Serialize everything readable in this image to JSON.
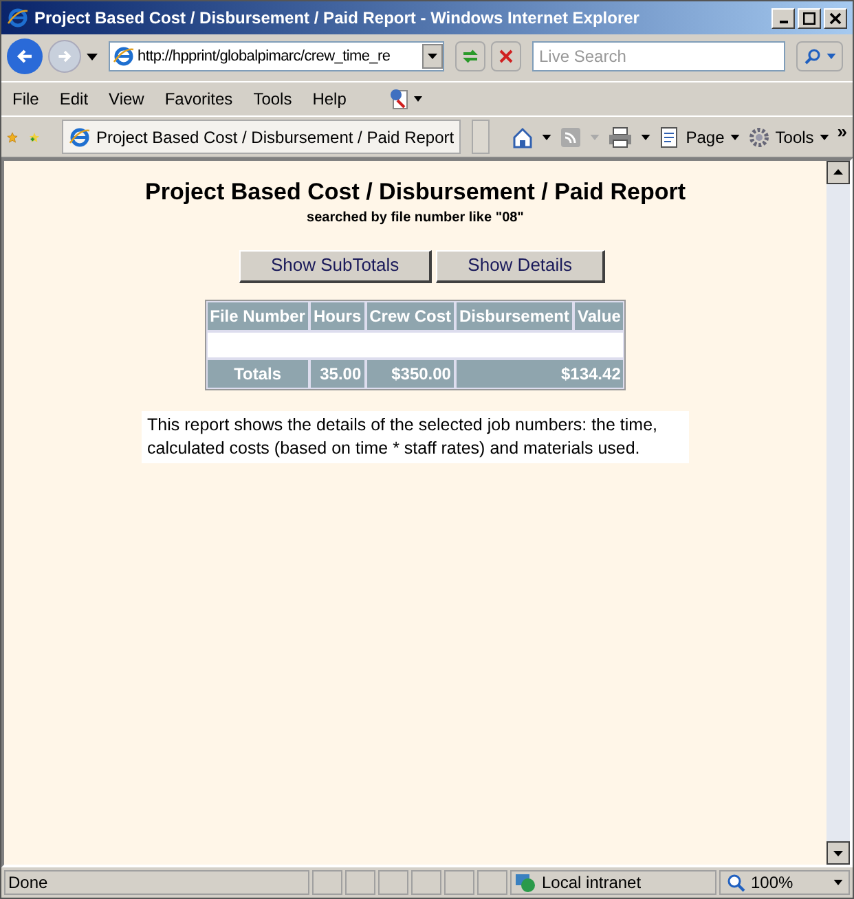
{
  "window": {
    "title": "Project Based Cost / Disbursement / Paid Report - Windows Internet Explorer"
  },
  "address_bar": {
    "value": "http://hpprint/globalpimarc/crew_time_re"
  },
  "search": {
    "placeholder": "Live Search"
  },
  "menu": [
    "File",
    "Edit",
    "View",
    "Favorites",
    "Tools",
    "Help"
  ],
  "tab": {
    "label": "Project Based Cost / Disbursement / Paid Report"
  },
  "command_bar": {
    "page": "Page",
    "tools": "Tools",
    "more": "»"
  },
  "report": {
    "title": "Project Based Cost / Disbursement / Paid Report",
    "subtitle": "searched by file number like \"08\"",
    "buttons": [
      "Show SubTotals",
      "Show Details"
    ],
    "table": {
      "columns": [
        "File Number",
        "Hours",
        "Crew Cost",
        "Disbursement",
        "Value"
      ],
      "totals": [
        "Totals",
        "35.00",
        "$350.00",
        "$134.42"
      ]
    },
    "note": "This report shows the details of the selected job numbers: the time, calculated costs (based on time * staff rates) and materials used."
  },
  "status_bar": {
    "status": "Done",
    "zone": "Local intranet",
    "zoom": "100%"
  }
}
